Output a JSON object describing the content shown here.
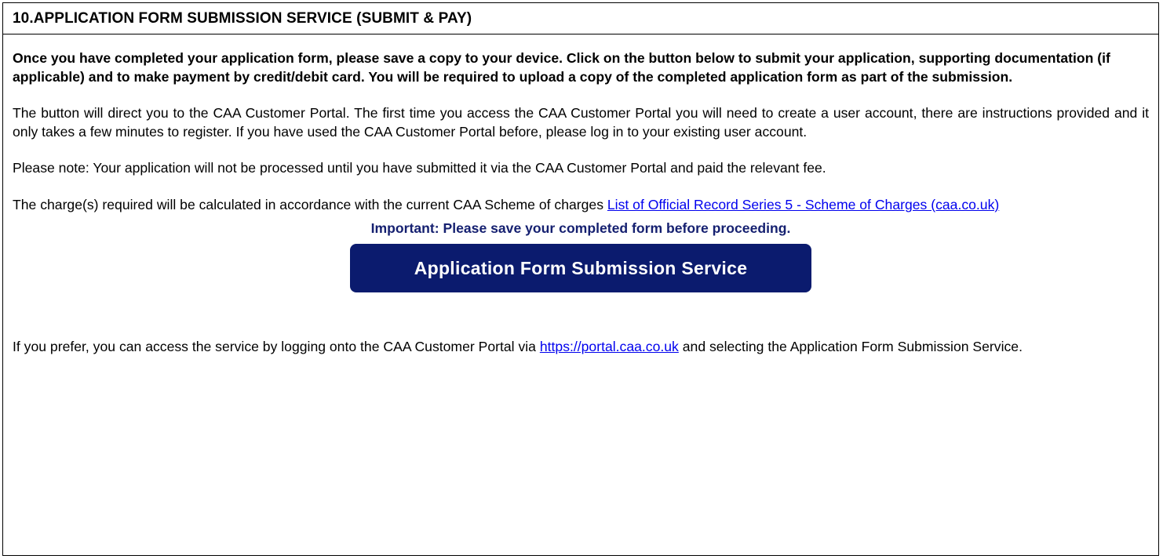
{
  "section": {
    "title": "10.APPLICATION FORM SUBMISSION SERVICE (SUBMIT & PAY)"
  },
  "intro": "Once you have completed your application form, please save a copy to your device. Click on the button below to submit your application, supporting documentation (if applicable) and to make payment by credit/debit card. You will be required to upload a copy of the completed application form as part of the submission.",
  "portal_info": "The button will direct you to the CAA Customer Portal. The first time you access the CAA Customer Portal you will need to create a user account, there are instructions provided and it only takes a few minutes to register.  If you have used the CAA Customer Portal before, please log in to your existing user account.",
  "note": "Please note: Your application will not be processed until you have submitted it via the CAA Customer Portal and paid the relevant fee.",
  "charges": {
    "text": "The charge(s) required will be calculated in accordance with the current CAA Scheme of charges ",
    "link_text": "List of Official Record Series 5 - Scheme of Charges (caa.co.uk)"
  },
  "important": "Important: Please save your completed form before proceeding.",
  "submit_button_label": "Application Form Submission Service",
  "prefer": {
    "before": "If you prefer, you can access the service by logging onto the CAA Customer Portal via ",
    "link_text": "https://portal.caa.co.uk",
    "after": " and selecting the Application Form Submission Service."
  },
  "colors": {
    "button_bg": "#0b1b6e",
    "important_text": "#152070",
    "link": "#0000ee"
  }
}
